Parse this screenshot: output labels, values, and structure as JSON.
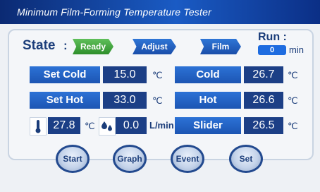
{
  "window": {
    "title": "Minimum Film-Forming Temperature Tester"
  },
  "state": {
    "label": "State",
    "colon": ":",
    "steps": [
      "Ready",
      "Adjust",
      "Film"
    ]
  },
  "run": {
    "label": "Run :",
    "value": "0",
    "unit": "min"
  },
  "left_fields": [
    {
      "label": "Set Cold",
      "value": "15.0",
      "unit": "℃"
    },
    {
      "label": "Set Hot",
      "value": "33.0",
      "unit": "℃"
    }
  ],
  "right_fields": [
    {
      "label": "Cold",
      "value": "26.7",
      "unit": "℃"
    },
    {
      "label": "Hot",
      "value": "26.6",
      "unit": "℃"
    },
    {
      "label": "Slider",
      "value": "26.5",
      "unit": "℃"
    }
  ],
  "ambient": {
    "temp_icon": "thermometer-icon",
    "temp_value": "27.8",
    "temp_unit": "℃",
    "flow_icon": "droplets-icon",
    "flow_value": "0.0",
    "flow_unit": "L/min"
  },
  "buttons": [
    "Start",
    "Graph",
    "Event",
    "Set"
  ],
  "colors": {
    "titlebar": "#1a5bc4",
    "label_blue": "#2c72d6",
    "value_navy": "#1c3f86",
    "ready_green": "#3aa035"
  }
}
